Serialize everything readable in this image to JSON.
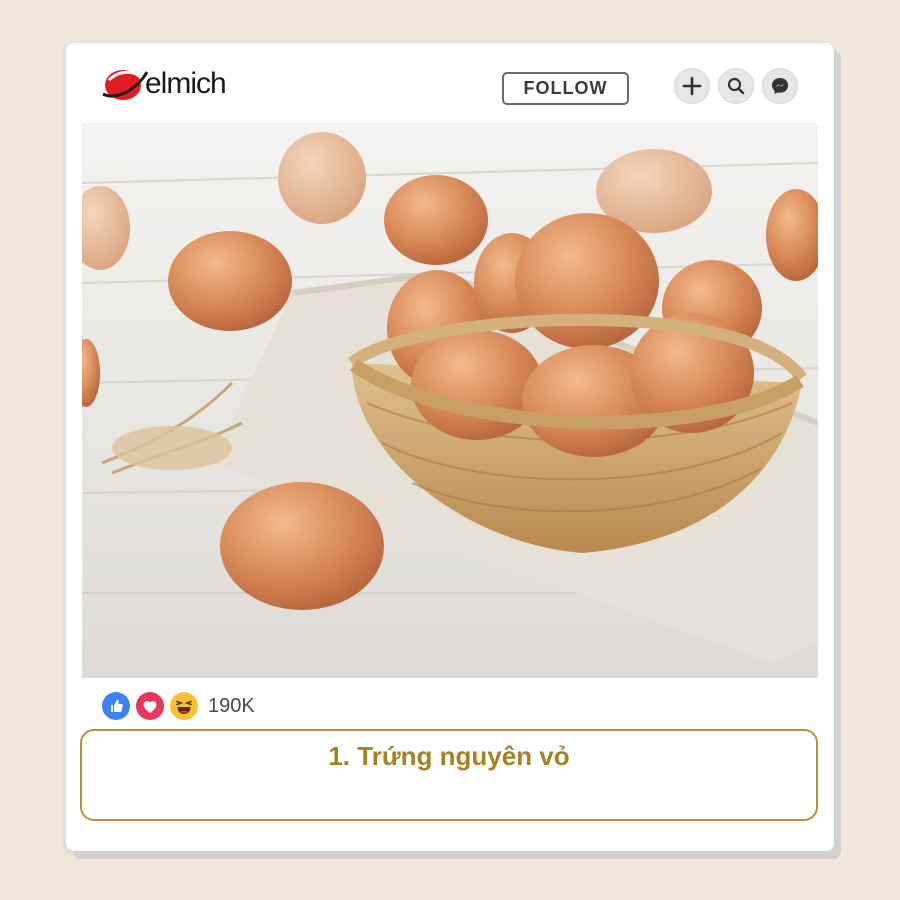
{
  "brand": {
    "name": "elmich",
    "color": "#e31b23"
  },
  "header": {
    "follow_label": "FOLLOW",
    "icons": [
      "plus-icon",
      "search-icon",
      "messenger-icon"
    ]
  },
  "post": {
    "image_alt": "brown-eggs-in-wicker-basket",
    "reactions": [
      "like-icon",
      "love-icon",
      "haha-icon"
    ],
    "reaction_count": "190K",
    "caption": "1. Trứng nguyên vỏ",
    "caption_color": "#a78224"
  }
}
